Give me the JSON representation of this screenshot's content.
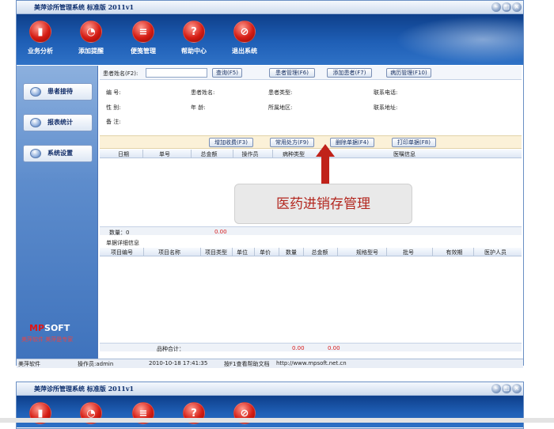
{
  "window": {
    "title": "美萍诊所管理系统 标准版 2011v1"
  },
  "toolbar": [
    {
      "label": "业务分析",
      "icon": "chart-icon"
    },
    {
      "label": "添加提醒",
      "icon": "clock-icon"
    },
    {
      "label": "便笺管理",
      "icon": "notepad-icon"
    },
    {
      "label": "帮助中心",
      "icon": "help-icon"
    },
    {
      "label": "退出系统",
      "icon": "exit-icon"
    }
  ],
  "sidebar": {
    "items": [
      {
        "label": "患者接待"
      },
      {
        "label": "报表统计"
      },
      {
        "label": "系统设置"
      }
    ],
    "logo": "MPSOFT",
    "logo_prefix": "MP",
    "logo_suffix": "SOFT",
    "slogan": "美萍软件 美萍是专家"
  },
  "patient": {
    "name_label": "患者姓名(F2):",
    "name_value": "",
    "query_button": "查询(F5)",
    "manage_button": "患者管理(F6)",
    "add_button": "添加患者(F7)",
    "history_button": "病历管理(F10)",
    "fields": {
      "id": "编 号:",
      "patient_name": "患者姓名:",
      "type": "患者类型:",
      "phone": "联系电话:",
      "gender": "性 别:",
      "age": "年 龄:",
      "region": "所属地区:",
      "address": "联系地址:",
      "note": "备 注:"
    }
  },
  "actions": {
    "add_fee": "增加收费(F3)",
    "common_rx": "常用处方(F9)",
    "delete": "删除单据(F4)",
    "print": "打印单据(F8)"
  },
  "orders": {
    "columns": [
      "日期",
      "单号",
      "总金额",
      "操作员",
      "病种类型",
      "医嘱信息"
    ],
    "count_label": "数量：0",
    "total": "0.00"
  },
  "details": {
    "section_title": "单据详细信息",
    "columns": [
      "项目编号",
      "项目名称",
      "项目类型",
      "单位",
      "单价",
      "数量",
      "总金额",
      "规格型号",
      "批号",
      "有效期",
      "医护人员"
    ],
    "sum_label": "品种合计：",
    "sum_qty": "0.00",
    "sum_amount": "0.00"
  },
  "status": {
    "company": "美萍软件",
    "operator": "操作员:admin",
    "datetime": "2010-10-18 17:41:35",
    "help": "按F1查看帮助文档",
    "url": "http://www.mpsoft.net.cn"
  },
  "overlay": {
    "caption": "医药进销存管理"
  },
  "colors": {
    "accent": "#2f72c6",
    "overlay_text": "#b3271f",
    "arrow": "#c0221a"
  }
}
